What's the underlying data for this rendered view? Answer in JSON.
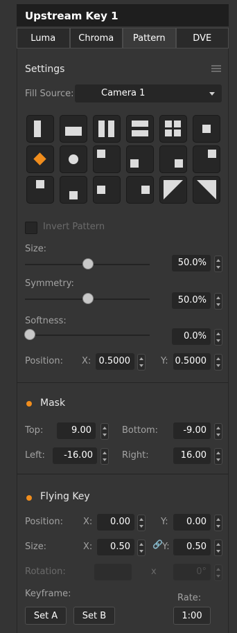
{
  "header": {
    "title": "Upstream Key 1"
  },
  "tabs": [
    {
      "label": "Luma"
    },
    {
      "label": "Chroma"
    },
    {
      "label": "Pattern"
    },
    {
      "label": "DVE"
    }
  ],
  "settings": {
    "title": "Settings",
    "fill_source_label": "Fill Source:",
    "fill_source_value": "Camera 1",
    "invert_label": "Invert Pattern"
  },
  "size": {
    "label": "Size:",
    "value": "50.0%",
    "level": 0.5
  },
  "symmetry": {
    "label": "Symmetry:",
    "value": "50.0%",
    "level": 0.5
  },
  "softness": {
    "label": "Softness:",
    "value": "0.0%",
    "level": 0.0
  },
  "position": {
    "label": "Position:",
    "x_label": "X:",
    "x_value": "0.5000",
    "y_label": "Y:",
    "y_value": "0.5000"
  },
  "mask": {
    "title": "Mask",
    "top_label": "Top:",
    "top_value": "9.00",
    "bottom_label": "Bottom:",
    "bottom_value": "-9.00",
    "left_label": "Left:",
    "left_value": "-16.00",
    "right_label": "Right:",
    "right_value": "16.00"
  },
  "flying_key": {
    "title": "Flying Key",
    "position_label": "Position:",
    "pos_x_label": "X:",
    "pos_x": "0.00",
    "pos_y_label": "Y:",
    "pos_y": "0.00",
    "size_label": "Size:",
    "size_x_label": "X:",
    "size_x": "0.50",
    "size_y_label": "Y:",
    "size_y": "0.50",
    "rotation_label": "Rotation:",
    "rotation_x_label": "x",
    "rotation_value": "0°",
    "keyframe_label": "Keyframe:",
    "rate_label": "Rate:",
    "set_a": "Set A",
    "set_b": "Set B",
    "rate_value": "1:00"
  },
  "colors": {
    "accent": "#f08d1d",
    "panel": "#353535"
  }
}
